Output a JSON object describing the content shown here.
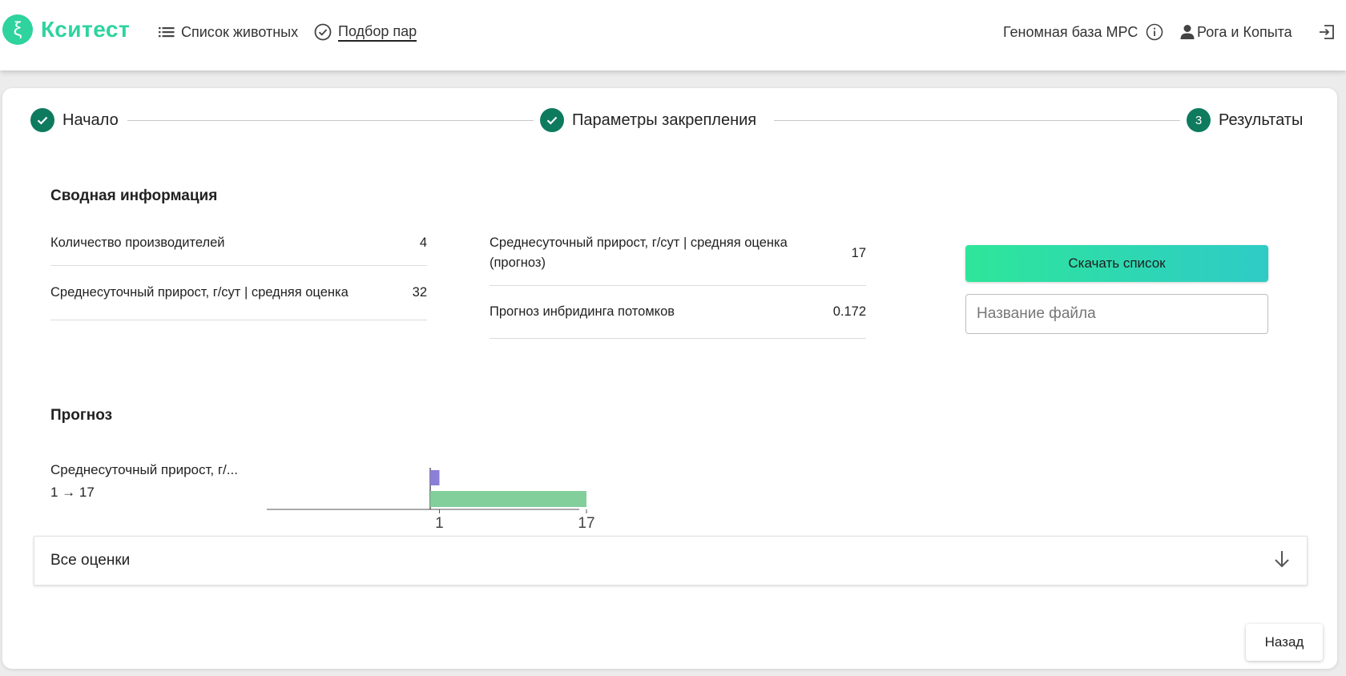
{
  "header": {
    "logo_symbol": "ξ",
    "logo_text": "Кситест",
    "nav": [
      {
        "label": "Список животных",
        "icon": "list-icon",
        "active": false
      },
      {
        "label": "Подбор пар",
        "icon": "check-circle-icon",
        "active": true
      }
    ],
    "database_label": "Геномная база МРС",
    "user_name": "Рога и Копыта",
    "brand_color": "#2ed39e"
  },
  "stepper": {
    "steps": [
      {
        "label": "Начало",
        "state": "done"
      },
      {
        "label": "Параметры закрепления",
        "state": "done"
      },
      {
        "label": "Результаты",
        "state": "current",
        "number": "3"
      }
    ],
    "accent": "#0e7a5e"
  },
  "summary": {
    "title": "Сводная информация",
    "left": [
      {
        "label": "Количество производителей",
        "value": "4"
      },
      {
        "label": "Среднесуточный прирост, г/сут | средняя оценка",
        "value": "32"
      }
    ],
    "right": [
      {
        "label": "Среднесуточный прирост, г/сут | средняя оценка (прогноз)",
        "value": "17"
      },
      {
        "label": "Прогноз инбридинга потомков",
        "value": "0.172"
      }
    ],
    "download_label": "Скачать список",
    "file_placeholder": "Название файла"
  },
  "forecast": {
    "title": "Прогноз",
    "trait_label": "Среднесуточный прирост, г/...",
    "trait_change": "1 → 17"
  },
  "chart_data": {
    "type": "bar",
    "orientation": "horizontal",
    "series": [
      {
        "values": [
          1
        ],
        "color": "#8b7fd8"
      },
      {
        "values": [
          17
        ],
        "color": "#82cf9c"
      }
    ],
    "tick_labels": [
      "1",
      "17"
    ]
  },
  "accordion": {
    "label": "Все оценки"
  },
  "footer": {
    "back_label": "Назад"
  }
}
